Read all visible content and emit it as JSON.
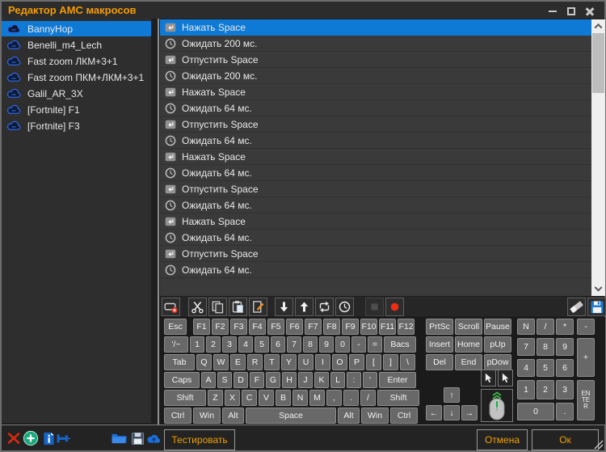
{
  "window": {
    "title": "Редактор АМС макросов",
    "controls": [
      "minimize-icon",
      "maximize-icon",
      "close-icon"
    ]
  },
  "sidebar": {
    "macros": [
      {
        "icon": "cloud-icon",
        "label": "BannyHop",
        "selected": true
      },
      {
        "icon": "cloud-icon",
        "label": "Benelli_m4_Lech",
        "selected": false
      },
      {
        "icon": "cloud-icon",
        "label": "Fast zoom ЛКМ+3+1",
        "selected": false
      },
      {
        "icon": "cloud-icon",
        "label": "Fast zoom ПКМ+ЛКМ+3+1",
        "selected": false
      },
      {
        "icon": "cloud-icon",
        "label": "Galil_AR_3X",
        "selected": false
      },
      {
        "icon": "cloud-icon",
        "label": "[Fortnite] F1",
        "selected": false
      },
      {
        "icon": "cloud-icon",
        "label": "[Fortnite] F3",
        "selected": false
      }
    ],
    "footer_icons": [
      {
        "name": "delete-macro-button",
        "icon": "red-x-icon"
      },
      {
        "name": "add-macro-button",
        "icon": "green-plus-icon"
      },
      {
        "name": "macro-info-button",
        "icon": "info-page-icon"
      },
      {
        "name": "pin-macro-button",
        "icon": "blue-pin-icon"
      },
      {
        "name": "open-macro-button",
        "icon": "folder-icon"
      },
      {
        "name": "import-macro-button",
        "icon": "floppy-dark-icon"
      },
      {
        "name": "cloud-macro-button",
        "icon": "cloud-upload-icon"
      }
    ]
  },
  "actions": {
    "items": [
      {
        "icon": "key-press-icon",
        "label": "Нажать Space",
        "selected": true
      },
      {
        "icon": "delay-icon",
        "label": "Ожидать 200 мс.",
        "selected": false
      },
      {
        "icon": "key-release-icon",
        "label": "Отпустить Space",
        "selected": false
      },
      {
        "icon": "delay-icon",
        "label": "Ожидать 200 мс.",
        "selected": false
      },
      {
        "icon": "key-press-icon",
        "label": "Нажать Space",
        "selected": false
      },
      {
        "icon": "delay-icon",
        "label": "Ожидать 64 мс.",
        "selected": false
      },
      {
        "icon": "key-release-icon",
        "label": "Отпустить Space",
        "selected": false
      },
      {
        "icon": "delay-icon",
        "label": "Ожидать 64 мс.",
        "selected": false
      },
      {
        "icon": "key-press-icon",
        "label": "Нажать Space",
        "selected": false
      },
      {
        "icon": "delay-icon",
        "label": "Ожидать 64 мс.",
        "selected": false
      },
      {
        "icon": "key-release-icon",
        "label": "Отпустить Space",
        "selected": false
      },
      {
        "icon": "delay-icon",
        "label": "Ожидать 64 мс.",
        "selected": false
      },
      {
        "icon": "key-press-icon",
        "label": "Нажать Space",
        "selected": false
      },
      {
        "icon": "delay-icon",
        "label": "Ожидать 64 мс.",
        "selected": false
      },
      {
        "icon": "key-release-icon",
        "label": "Отпустить Space",
        "selected": false
      },
      {
        "icon": "delay-icon",
        "label": "Ожидать 64 мс.",
        "selected": false
      }
    ]
  },
  "toolbar": {
    "buttons": [
      {
        "name": "remove-action-button",
        "icon": "remove-key-icon",
        "disabled": false
      },
      {
        "name": "cut-button",
        "icon": "scissors-icon",
        "disabled": false
      },
      {
        "name": "copy-button",
        "icon": "copy-icon",
        "disabled": false
      },
      {
        "name": "paste-button",
        "icon": "paste-icon",
        "disabled": false
      },
      {
        "name": "edit-button",
        "icon": "edit-icon",
        "disabled": false
      },
      {
        "name": "move-down-button",
        "icon": "arrow-down-icon",
        "disabled": false
      },
      {
        "name": "move-up-button",
        "icon": "arrow-up-icon",
        "disabled": false
      },
      {
        "name": "loop-button",
        "icon": "loop-icon",
        "disabled": false
      },
      {
        "name": "add-delay-button",
        "icon": "clock-icon",
        "disabled": false
      },
      {
        "name": "stop-button",
        "icon": "stop-icon",
        "disabled": true
      },
      {
        "name": "record-button",
        "icon": "record-icon",
        "disabled": false
      }
    ],
    "right_buttons": [
      {
        "name": "clear-button",
        "icon": "eraser-icon"
      },
      {
        "name": "save-button",
        "icon": "floppy-blue-icon"
      }
    ]
  },
  "keyboard": {
    "main_rows": [
      [
        "Esc",
        "F1",
        "F2",
        "F3",
        "F4",
        "F5",
        "F6",
        "F7",
        "F8",
        "F9",
        "F10",
        "F11",
        "F12"
      ],
      [
        "'/~",
        "1",
        "2",
        "3",
        "4",
        "5",
        "6",
        "7",
        "8",
        "9",
        "0",
        "-",
        "=",
        "Bacs"
      ],
      [
        "Tab",
        "Q",
        "W",
        "E",
        "R",
        "T",
        "Y",
        "U",
        "I",
        "O",
        "P",
        "[",
        "]",
        "\\"
      ],
      [
        "Caps",
        "A",
        "S",
        "D",
        "F",
        "G",
        "H",
        "J",
        "K",
        "L",
        ":",
        "'",
        "Enter"
      ],
      [
        "Shift",
        "Z",
        "X",
        "C",
        "V",
        "B",
        "N",
        "M",
        ",",
        ".",
        "/",
        "Shift"
      ],
      [
        "Ctrl",
        "Win",
        "Alt",
        "Space",
        "Alt",
        "Win",
        "Ctrl"
      ]
    ],
    "nav_rows": [
      [
        "PrtSc",
        "Scroll",
        "Pause"
      ],
      [
        "Insert",
        "Home",
        "pUp"
      ],
      [
        "Del",
        "End",
        "pDow"
      ]
    ],
    "numpad_row1": [
      "N",
      "/",
      "*",
      "-"
    ],
    "numpad_grid": [
      [
        "7",
        "8",
        "9"
      ],
      [
        "4",
        "5",
        "6"
      ],
      [
        "1",
        "2",
        "3"
      ]
    ],
    "numpad_plus": "+",
    "numpad_enter": "ENTER",
    "numpad_zero": "0",
    "numpad_dot": ".",
    "arrow_up": "↑",
    "arrow_left": "←",
    "arrow_down": "↓",
    "arrow_right": "→",
    "mouse_cluster_icons": [
      "cursor-left-icon",
      "cursor-right-icon",
      "mouse-icon"
    ]
  },
  "footer": {
    "test": "Тестировать",
    "cancel": "Отмена",
    "ok": "Ок"
  }
}
